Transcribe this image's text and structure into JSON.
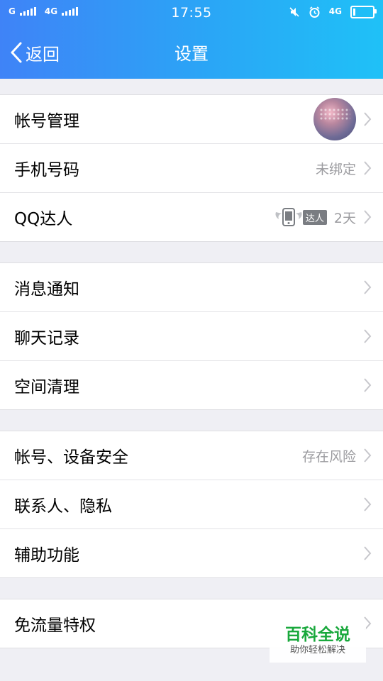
{
  "status_bar": {
    "carrier1": "G",
    "carrier2": "4G",
    "time": "17:55",
    "network_badge": "4G",
    "battery_level": 0.12
  },
  "header": {
    "back_label": "返回",
    "title": "设置"
  },
  "groups": [
    {
      "items": [
        {
          "label": "帐号管理",
          "value": "",
          "has_avatar": true
        },
        {
          "label": "手机号码",
          "value": "未绑定"
        },
        {
          "label": "QQ达人",
          "badge": "达人",
          "value": "2天"
        }
      ]
    },
    {
      "items": [
        {
          "label": "消息通知",
          "value": ""
        },
        {
          "label": "聊天记录",
          "value": ""
        },
        {
          "label": "空间清理",
          "value": ""
        }
      ]
    },
    {
      "items": [
        {
          "label": "帐号、设备安全",
          "value": "存在风险"
        },
        {
          "label": "联系人、隐私",
          "value": ""
        },
        {
          "label": "辅助功能",
          "value": ""
        }
      ]
    },
    {
      "items": [
        {
          "label": "免流量特权",
          "value": ""
        }
      ]
    }
  ],
  "watermark": {
    "title": "百科全说",
    "subtitle": "助你轻松解决"
  },
  "colors": {
    "header_gradient_start": "#3f83f7",
    "header_gradient_end": "#1fc1f7",
    "secondary_text": "#9c9ca0",
    "watermark_green": "#19a83c"
  },
  "icons": [
    "back-chevron-icon",
    "chevron-right-icon",
    "alarm-icon",
    "mute-icon",
    "battery-icon",
    "expert-badge-icon"
  ]
}
